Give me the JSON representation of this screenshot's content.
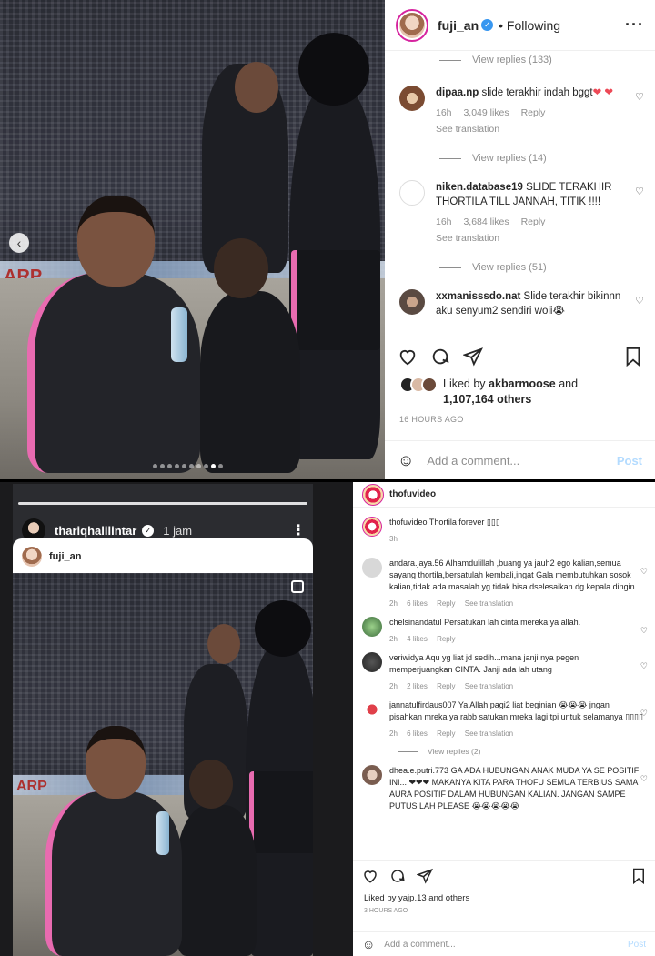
{
  "top_post": {
    "username": "fuji_an",
    "follow_status": "Following",
    "comments": [
      {
        "view_replies": "View replies (133)"
      },
      {
        "user": "dipaa.np",
        "text": "slide terakhir indah bggt",
        "hearts": "❤ ❤",
        "time": "16h",
        "likes": "3,049 likes",
        "reply": "Reply",
        "see_translation": "See translation",
        "view_replies": "View replies (14)"
      },
      {
        "user": "niken.database19",
        "text": "SLIDE TERAKHIR THORTILA TILL JANNAH, TITIK !!!!",
        "time": "16h",
        "likes": "3,684 likes",
        "reply": "Reply",
        "see_translation": "See translation",
        "view_replies": "View replies (51)"
      },
      {
        "user": "xxmanisssdo.nat",
        "text": "Slide terakhir bikinnn aku senyum2 sendiri woii😭"
      }
    ],
    "liked_by_user": "akbarmoose",
    "liked_by_rest": "1,107,164 others",
    "liked_prefix": "Liked by",
    "liked_and": "and",
    "time_ago": "16 HOURS AGO",
    "add_comment": "Add a comment...",
    "post_label": "Post"
  },
  "story": {
    "username": "thariqhalilintar",
    "time": "1 jam",
    "sticker_user": "fuji_an"
  },
  "bottom_post": {
    "username": "thofuvideo",
    "caption_user": "thofuvideo",
    "caption_text": "Thortila forever ▯▯▯",
    "caption_time": "3h",
    "comments": [
      {
        "user": "andara.jaya.56",
        "text": "Alhamdulillah ,buang ya jauh2 ego kalian,semua sayang thortila,bersatulah kembali,ingat Gala membutuhkan sosok kalian,tidak ada masalah yg tidak bisa dselesaikan dg kepala dingin .",
        "time": "2h",
        "likes": "6 likes",
        "reply": "Reply",
        "see_translation": "See translation"
      },
      {
        "user": "chelsinandatul",
        "text": "Persatukan lah cinta mereka ya allah.",
        "time": "2h",
        "likes": "4 likes",
        "reply": "Reply"
      },
      {
        "user": "veriwidya",
        "text": "Aqu yg liat jd sedih...mana janji nya pegen memperjuangkan CINTA. Janji ada lah utang",
        "time": "2h",
        "likes": "2 likes",
        "reply": "Reply",
        "see_translation": "See translation"
      },
      {
        "user": "jannatulfirdaus007",
        "text": "Ya Allah pagi2 liat beginian 😭😭😭 jngan pisahkan mreka ya rabb satukan mreka lagi tpi untuk selamanya ▯▯▯▯",
        "time": "2h",
        "likes": "6 likes",
        "reply": "Reply",
        "see_translation": "See translation",
        "view_replies": "View replies (2)"
      },
      {
        "user": "dhea.e.putri.773",
        "text": "GA ADA HUBUNGAN ANAK MUDA YA SE POSITIF INI... ❤❤❤ MAKANYA KITA PARA THOFU SEMUA TERBIUS SAMA AURA POSITIF DALAM HUBUNGAN KALIAN. JANGAN SAMPE PUTUS LAH PLEASE 😭😭😭😭😭"
      }
    ],
    "liked_text": "Liked by yajp.13 and others",
    "time_ago": "3 HOURS AGO",
    "add_comment": "Add a comment...",
    "post_label": "Post"
  }
}
